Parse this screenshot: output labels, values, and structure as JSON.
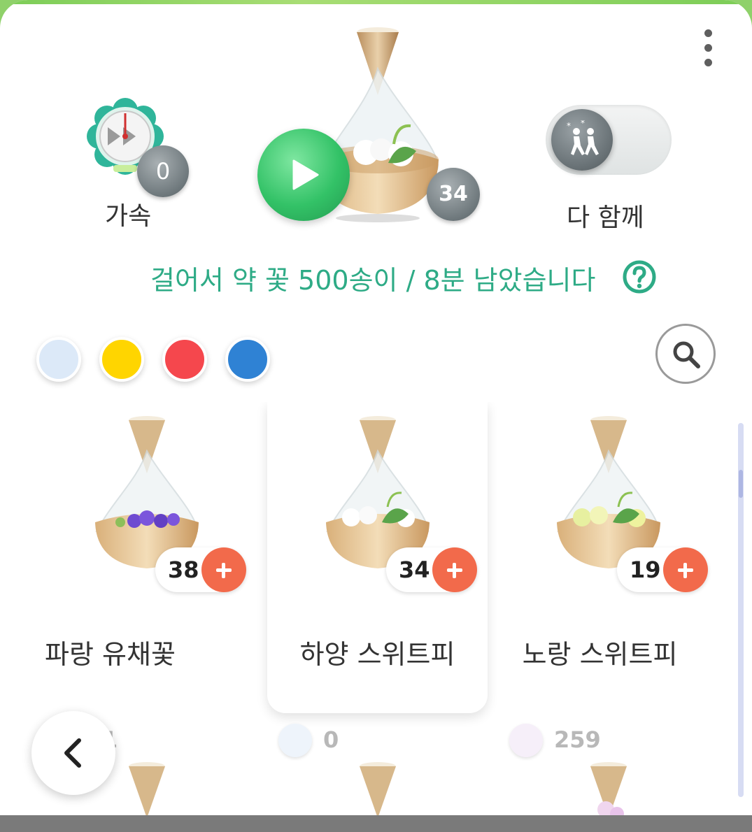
{
  "header": {
    "menu_icon": "more-vertical-icon"
  },
  "accelerate": {
    "label": "가속",
    "count": "0",
    "icon": "fast-forward-clock-icon"
  },
  "center": {
    "count": "34",
    "play_icon": "play-icon"
  },
  "together": {
    "label": "다 함께",
    "icon": "walking-people-icon"
  },
  "status": {
    "text": "걸어서 약 꽃 500송이 / 8분 남았습니다",
    "help_icon": "question-circle-icon"
  },
  "color_filters": [
    {
      "name": "light-blue",
      "color": "#dce9f8"
    },
    {
      "name": "yellow",
      "color": "#ffd500"
    },
    {
      "name": "red",
      "color": "#f5474d"
    },
    {
      "name": "blue",
      "color": "#2f82d4"
    }
  ],
  "search": {
    "icon": "search-icon"
  },
  "cards": [
    {
      "name": "파랑 유채꽃",
      "count": "38",
      "selected": false
    },
    {
      "name": "하양 스위트피",
      "count": "34",
      "selected": true
    },
    {
      "name": "노랑 스위트피",
      "count": "19",
      "selected": false
    }
  ],
  "seed_counts": [
    {
      "value": "1"
    },
    {
      "value": "0"
    },
    {
      "value": "259"
    }
  ],
  "colors": {
    "accent_green": "#2eab86",
    "plus_orange": "#f26a4b",
    "play_green": "#33c267"
  },
  "back": {
    "icon": "chevron-left-icon"
  }
}
